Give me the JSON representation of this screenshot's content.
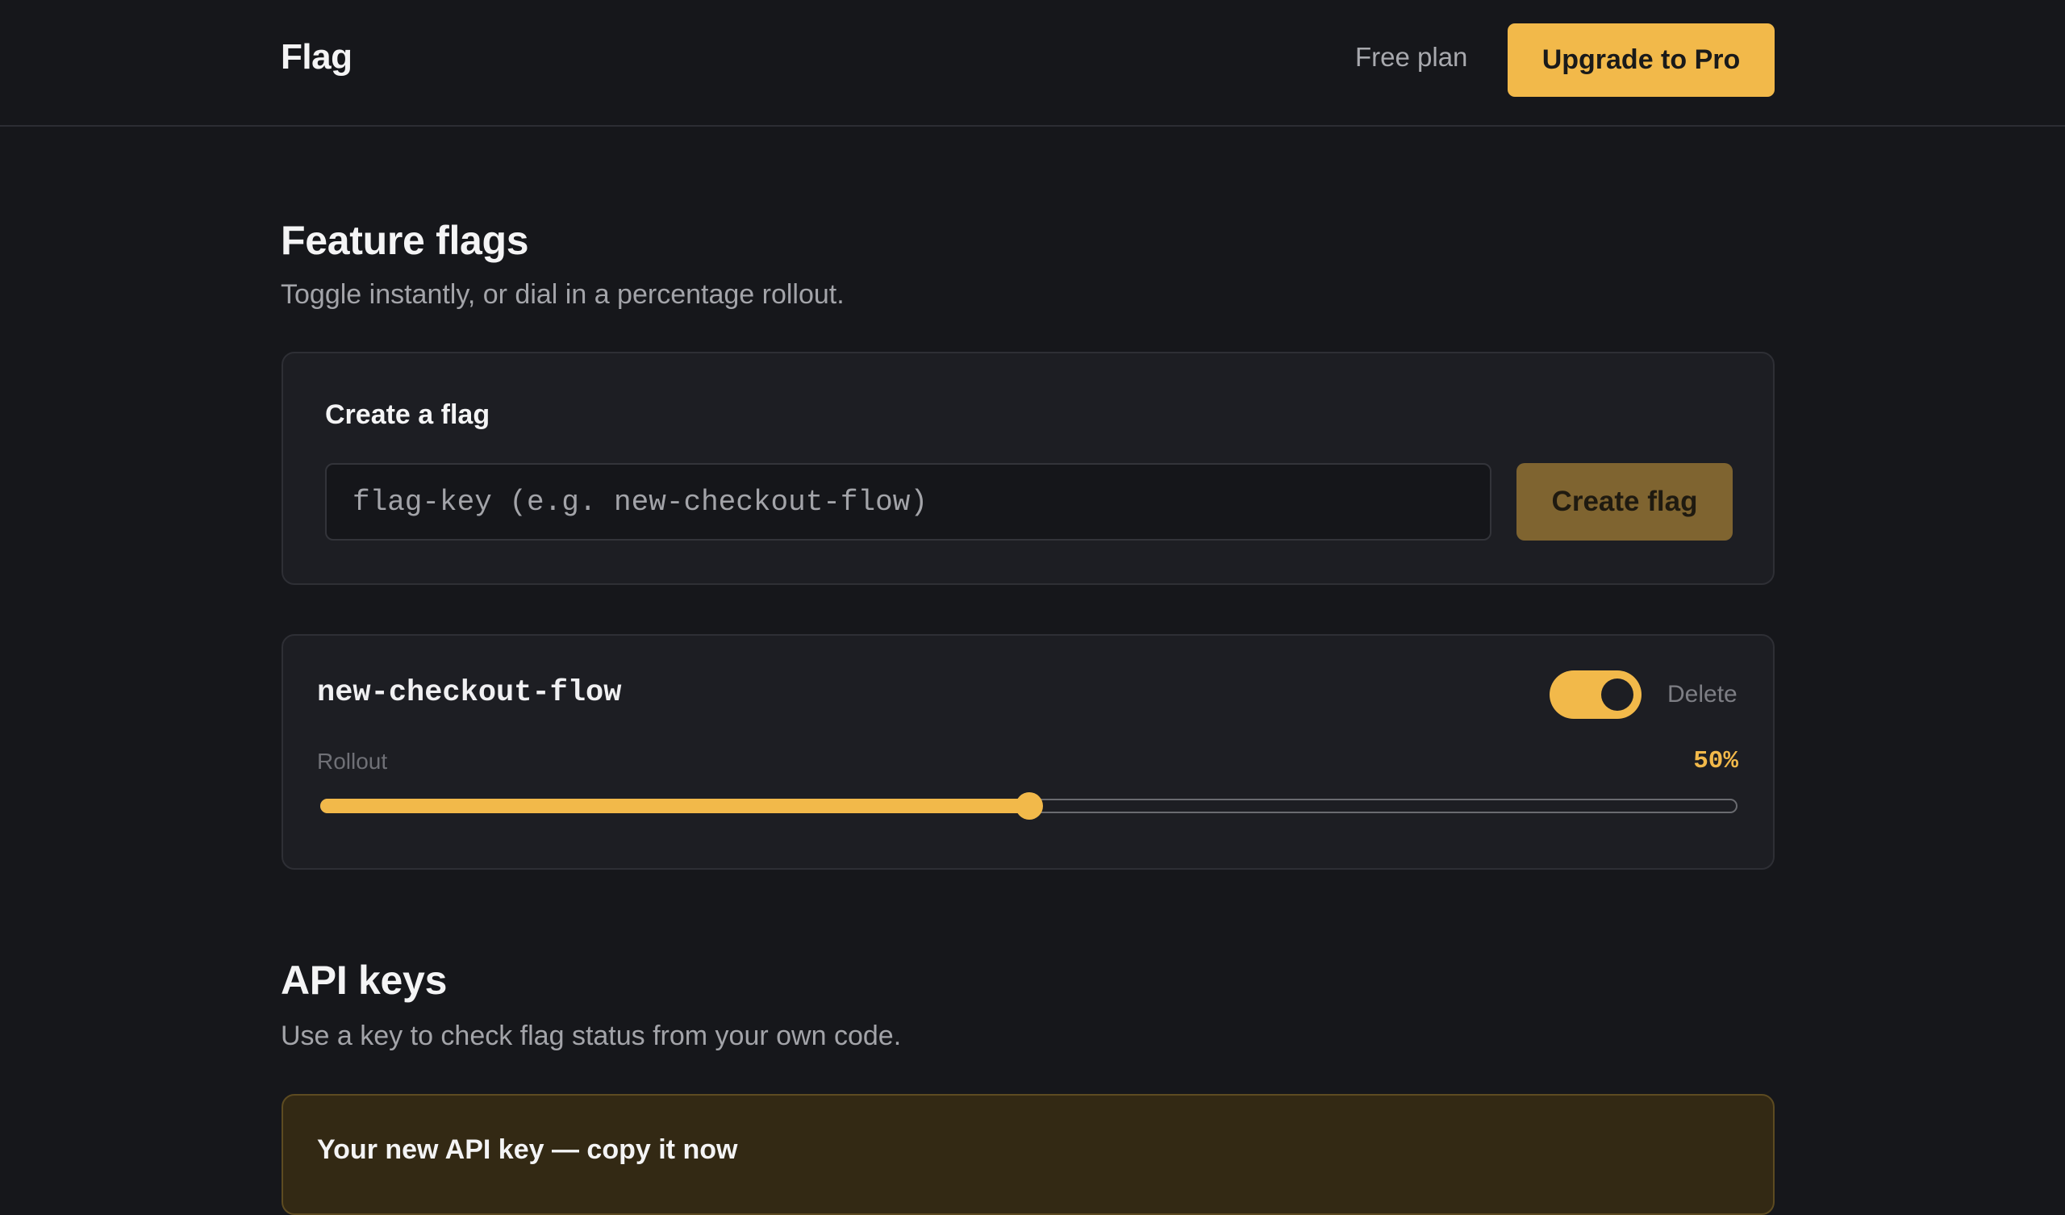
{
  "header": {
    "brand": "Flag",
    "plan": "Free plan",
    "upgrade_label": "Upgrade to Pro"
  },
  "flags_section": {
    "title": "Feature flags",
    "subtitle": "Toggle instantly, or dial in a percentage rollout."
  },
  "create_flag": {
    "label": "Create a flag",
    "input_value": "",
    "input_placeholder": "flag-key (e.g. new-checkout-flow)",
    "button_label": "Create flag"
  },
  "flags": [
    {
      "key": "new-checkout-flow",
      "enabled": true,
      "delete_label": "Delete",
      "rollout_label": "Rollout",
      "rollout_percent": 50,
      "rollout_display": "50%"
    }
  ],
  "api_section": {
    "title": "API keys",
    "subtitle": "Use a key to check flag status from your own code.",
    "new_key_title": "Your new API key — copy it now"
  },
  "colors": {
    "accent": "#f2b94a",
    "background": "#16171b",
    "card": "#1d1e23",
    "muted_accent": "#7f6430"
  }
}
